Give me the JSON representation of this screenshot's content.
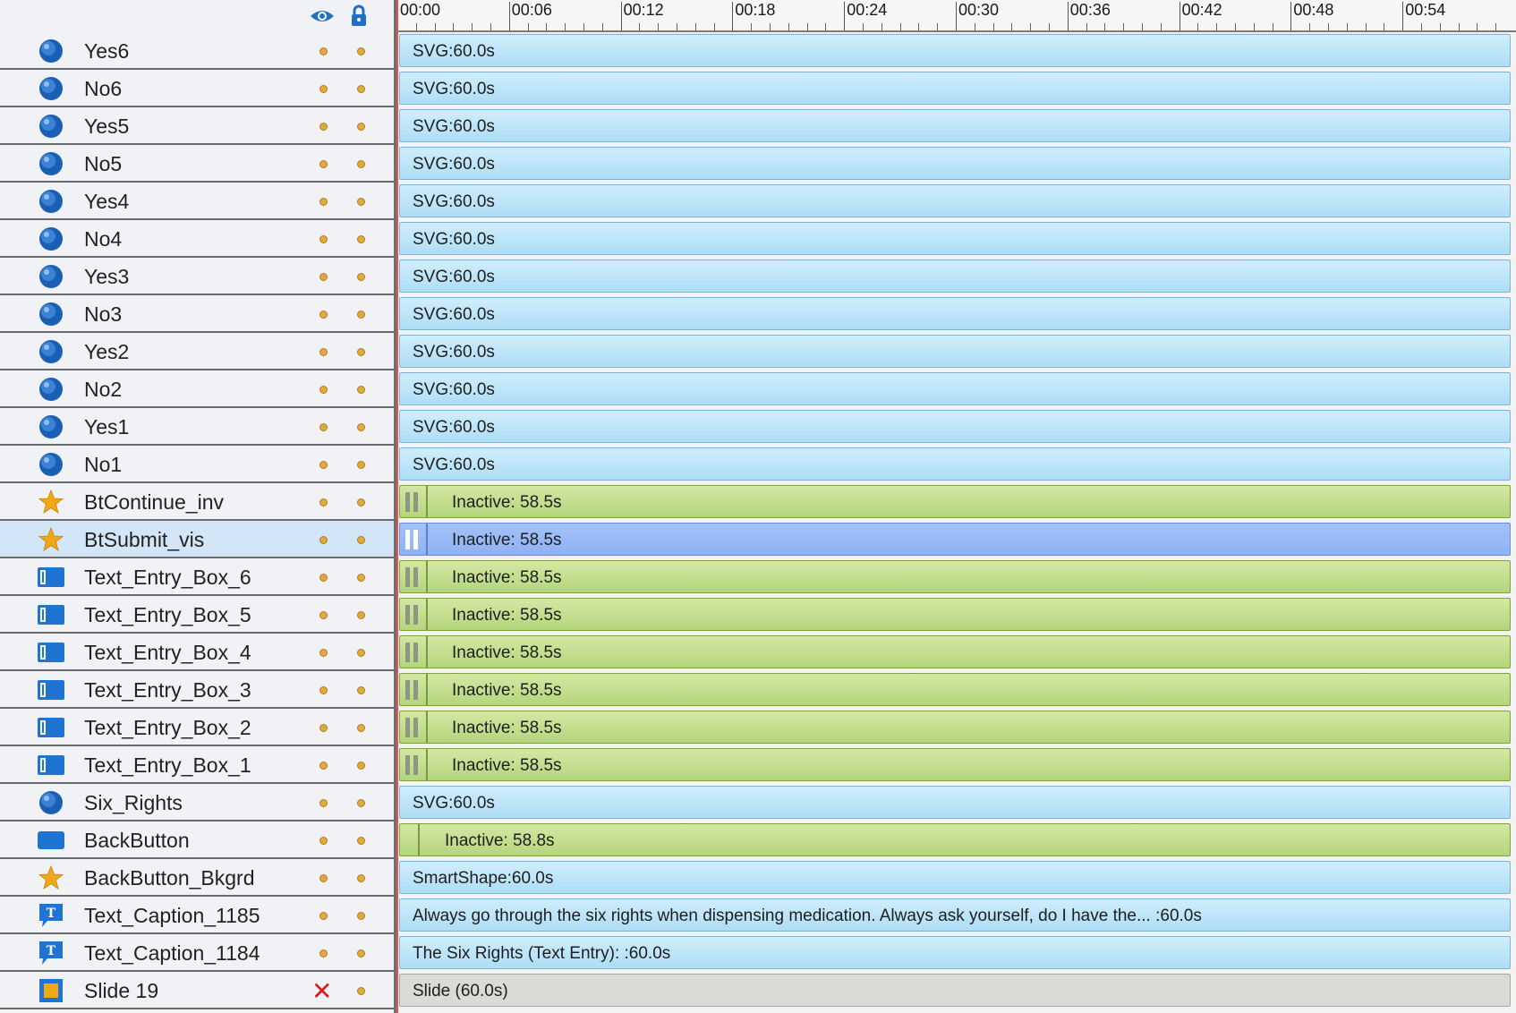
{
  "header": {
    "visibility_icon": "eye-icon",
    "lock_icon": "lock-icon",
    "ruler_ticks": [
      "00:00",
      "00:06",
      "00:12",
      "00:18",
      "00:24",
      "00:30",
      "00:36",
      "00:42",
      "00:48",
      "00:54"
    ]
  },
  "layers": [
    {
      "name": "Yes6",
      "icon": "svg-globe-icon",
      "bar_type": "svg",
      "bar_label": "SVG:60.0s",
      "selected": false,
      "hidden": false
    },
    {
      "name": "No6",
      "icon": "svg-globe-icon",
      "bar_type": "svg",
      "bar_label": "SVG:60.0s",
      "selected": false,
      "hidden": false
    },
    {
      "name": "Yes5",
      "icon": "svg-globe-icon",
      "bar_type": "svg",
      "bar_label": "SVG:60.0s",
      "selected": false,
      "hidden": false
    },
    {
      "name": "No5",
      "icon": "svg-globe-icon",
      "bar_type": "svg",
      "bar_label": "SVG:60.0s",
      "selected": false,
      "hidden": false
    },
    {
      "name": "Yes4",
      "icon": "svg-globe-icon",
      "bar_type": "svg",
      "bar_label": "SVG:60.0s",
      "selected": false,
      "hidden": false
    },
    {
      "name": "No4",
      "icon": "svg-globe-icon",
      "bar_type": "svg",
      "bar_label": "SVG:60.0s",
      "selected": false,
      "hidden": false
    },
    {
      "name": "Yes3",
      "icon": "svg-globe-icon",
      "bar_type": "svg",
      "bar_label": "SVG:60.0s",
      "selected": false,
      "hidden": false
    },
    {
      "name": "No3",
      "icon": "svg-globe-icon",
      "bar_type": "svg",
      "bar_label": "SVG:60.0s",
      "selected": false,
      "hidden": false
    },
    {
      "name": "Yes2",
      "icon": "svg-globe-icon",
      "bar_type": "svg",
      "bar_label": "SVG:60.0s",
      "selected": false,
      "hidden": false
    },
    {
      "name": "No2",
      "icon": "svg-globe-icon",
      "bar_type": "svg",
      "bar_label": "SVG:60.0s",
      "selected": false,
      "hidden": false
    },
    {
      "name": "Yes1",
      "icon": "svg-globe-icon",
      "bar_type": "svg",
      "bar_label": "SVG:60.0s",
      "selected": false,
      "hidden": false
    },
    {
      "name": "No1",
      "icon": "svg-globe-icon",
      "bar_type": "svg",
      "bar_label": "SVG:60.0s",
      "selected": false,
      "hidden": false
    },
    {
      "name": "BtContinue_inv",
      "icon": "star-icon",
      "bar_type": "inactive",
      "bar_label": "Inactive: 58.5s",
      "selected": false,
      "hidden": false
    },
    {
      "name": "BtSubmit_vis",
      "icon": "star-icon",
      "bar_type": "inactive",
      "bar_label": "Inactive: 58.5s",
      "selected": true,
      "hidden": false
    },
    {
      "name": "Text_Entry_Box_6",
      "icon": "text-entry-icon",
      "bar_type": "inactive",
      "bar_label": "Inactive: 58.5s",
      "selected": false,
      "hidden": false
    },
    {
      "name": "Text_Entry_Box_5",
      "icon": "text-entry-icon",
      "bar_type": "inactive",
      "bar_label": "Inactive: 58.5s",
      "selected": false,
      "hidden": false
    },
    {
      "name": "Text_Entry_Box_4",
      "icon": "text-entry-icon",
      "bar_type": "inactive",
      "bar_label": "Inactive: 58.5s",
      "selected": false,
      "hidden": false
    },
    {
      "name": "Text_Entry_Box_3",
      "icon": "text-entry-icon",
      "bar_type": "inactive",
      "bar_label": "Inactive: 58.5s",
      "selected": false,
      "hidden": false
    },
    {
      "name": "Text_Entry_Box_2",
      "icon": "text-entry-icon",
      "bar_type": "inactive",
      "bar_label": "Inactive: 58.5s",
      "selected": false,
      "hidden": false
    },
    {
      "name": "Text_Entry_Box_1",
      "icon": "text-entry-icon",
      "bar_type": "inactive",
      "bar_label": "Inactive: 58.5s",
      "selected": false,
      "hidden": false
    },
    {
      "name": "Six_Rights",
      "icon": "svg-globe-icon",
      "bar_type": "svg",
      "bar_label": "SVG:60.0s",
      "selected": false,
      "hidden": false
    },
    {
      "name": "BackButton",
      "icon": "button-icon",
      "bar_type": "inactive-short",
      "bar_label": "Inactive: 58.8s",
      "selected": false,
      "hidden": false
    },
    {
      "name": "BackButton_Bkgrd",
      "icon": "star-icon",
      "bar_type": "svg",
      "bar_label": "SmartShape:60.0s",
      "selected": false,
      "hidden": false
    },
    {
      "name": "Text_Caption_1185",
      "icon": "text-caption-icon",
      "bar_type": "svg",
      "bar_label": "Always go through the six rights when dispensing medication. Always ask yourself, do I have the... :60.0s",
      "selected": false,
      "hidden": false
    },
    {
      "name": "Text_Caption_1184",
      "icon": "text-caption-icon",
      "bar_type": "svg",
      "bar_label": "The Six Rights (Text Entry):    :60.0s",
      "selected": false,
      "hidden": false
    },
    {
      "name": "Slide 19",
      "icon": "slide-icon",
      "bar_type": "slide",
      "bar_label": "Slide (60.0s)",
      "selected": false,
      "hidden": true
    }
  ],
  "colors": {
    "svg_bar": "#bfe6f9",
    "inactive_bar": "#c3df8f",
    "selected_bar": "#98b8f7",
    "slide_bar": "#dcdad5",
    "playhead": "#e0574f",
    "dot": "#e2a93b",
    "hidden_mark": "#d81e1e"
  }
}
